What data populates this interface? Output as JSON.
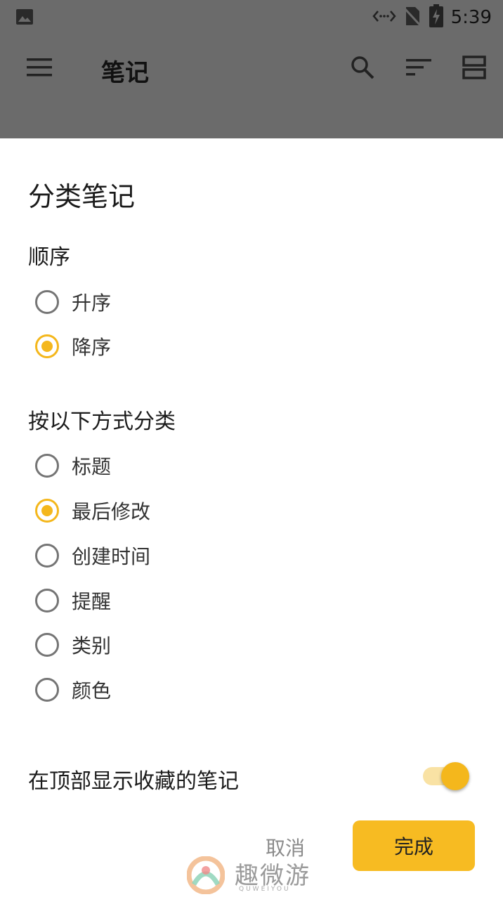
{
  "status_bar": {
    "time": "5:39",
    "icons": [
      "image-icon",
      "data-transfer-icon",
      "no-sim-icon",
      "battery-charging-icon"
    ]
  },
  "app_bar": {
    "title": "笔记",
    "icons": [
      "menu-icon",
      "search-icon",
      "sort-icon",
      "view-layout-icon"
    ]
  },
  "dialog": {
    "title": "分类笔记",
    "order_section": {
      "label": "顺序",
      "options": [
        {
          "label": "升序",
          "selected": false
        },
        {
          "label": "降序",
          "selected": true
        }
      ]
    },
    "sort_by_section": {
      "label": "按以下方式分类",
      "options": [
        {
          "label": "标题",
          "selected": false
        },
        {
          "label": "最后修改",
          "selected": true
        },
        {
          "label": "创建时间",
          "selected": false
        },
        {
          "label": "提醒",
          "selected": false
        },
        {
          "label": "类别",
          "selected": false
        },
        {
          "label": "颜色",
          "selected": false
        }
      ]
    },
    "toggle": {
      "label": "在顶部显示收藏的笔记",
      "on": true
    },
    "cancel_label": "取消",
    "done_label": "完成"
  },
  "watermark": {
    "text": "趣微游",
    "sub": "QUWEIYOU"
  },
  "colors": {
    "accent": "#f4b71c",
    "scrim": "#6b6b6b"
  }
}
